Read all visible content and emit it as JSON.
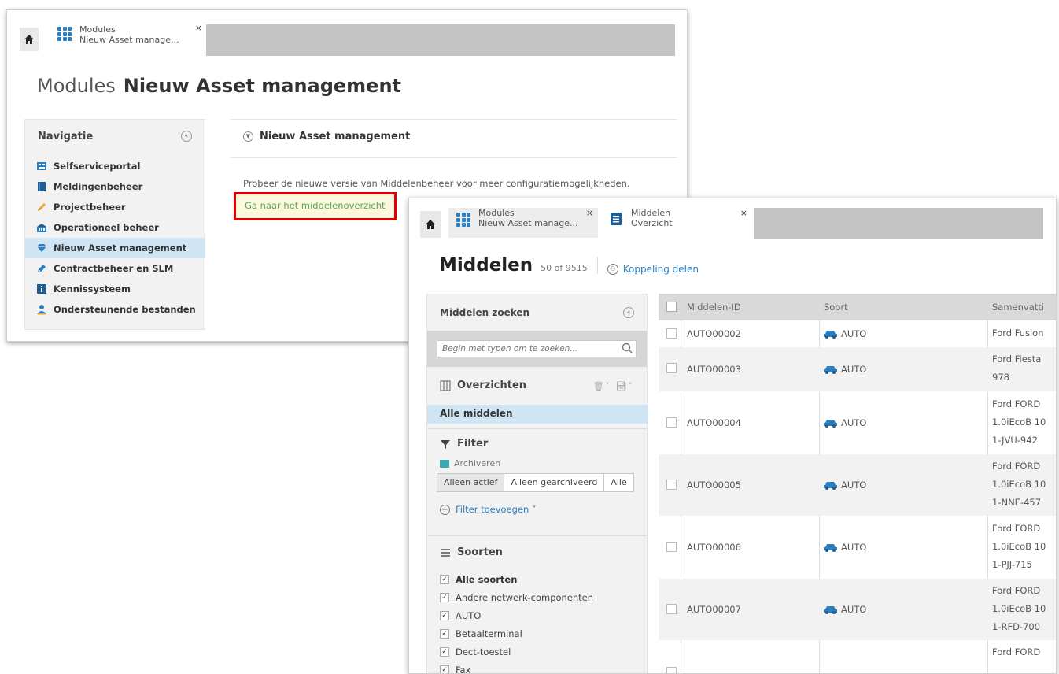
{
  "window1": {
    "tab": {
      "line1": "Modules",
      "line2": "Nieuw Asset manage...",
      "close": "×"
    },
    "title_light": "Modules",
    "title_bold": "Nieuw Asset management",
    "nav": {
      "header": "Navigatie",
      "collapse": "«",
      "items": [
        {
          "label": "Selfserviceportal",
          "icon": "portal-icon"
        },
        {
          "label": "Meldingenbeheer",
          "icon": "book-icon"
        },
        {
          "label": "Projectbeheer",
          "icon": "pencil-icon"
        },
        {
          "label": "Operationeel beheer",
          "icon": "building-icon"
        },
        {
          "label": "Nieuw Asset management",
          "icon": "diamond-icon",
          "active": true
        },
        {
          "label": "Contractbeheer en SLM",
          "icon": "pen-icon"
        },
        {
          "label": "Kennissysteem",
          "icon": "info-icon"
        },
        {
          "label": "Ondersteunende bestanden",
          "icon": "person-icon"
        }
      ]
    },
    "panel": {
      "header": "Nieuw Asset management",
      "description": "Probeer de nieuwe versie van Middelenbeheer voor meer configuratiemogelijkheden.",
      "link": "Ga naar het middelenoverzicht"
    }
  },
  "window2": {
    "tabs": [
      {
        "line1": "Modules",
        "line2": "Nieuw Asset manage...",
        "close": "×"
      },
      {
        "line1": "Middelen",
        "line2": "Overzicht",
        "close": "×"
      }
    ],
    "title": "Middelen",
    "count": "50 of 9515",
    "share": "Koppeling delen",
    "search": {
      "header": "Middelen zoeken",
      "collapse": "«",
      "placeholder": "Begin met typen om te zoeken..."
    },
    "overviews": {
      "header": "Overzichten",
      "actions": "🗑︎˅ 💾︎˅",
      "selected": "Alle middelen"
    },
    "filter": {
      "header": "Filter",
      "archive_label": "Archiveren",
      "segments": [
        "Alleen actief",
        "Alleen gearchiveerd",
        "Alle"
      ],
      "add": "Filter toevoegen ˅"
    },
    "types": {
      "header": "Soorten",
      "items": [
        {
          "label": "Alle soorten",
          "bold": true
        },
        {
          "label": "Andere netwerk-componenten"
        },
        {
          "label": "AUTO"
        },
        {
          "label": "Betaalterminal"
        },
        {
          "label": "Dect-toestel"
        },
        {
          "label": "Fax"
        }
      ]
    },
    "table": {
      "columns": [
        "Middelen-ID",
        "Soort",
        "Samenvatti"
      ],
      "rows": [
        {
          "id": "AUTO00002",
          "soort": "AUTO",
          "summary": [
            "Ford Fusion"
          ]
        },
        {
          "id": "AUTO00003",
          "soort": "AUTO",
          "summary": [
            "Ford Fiesta",
            "978"
          ]
        },
        {
          "id": "AUTO00004",
          "soort": "AUTO",
          "summary": [
            "Ford FORD",
            "1.0iEcoB 10",
            "1-JVU-942"
          ]
        },
        {
          "id": "AUTO00005",
          "soort": "AUTO",
          "summary": [
            "Ford FORD",
            "1.0iEcoB 10",
            "1-NNE-457"
          ]
        },
        {
          "id": "AUTO00006",
          "soort": "AUTO",
          "summary": [
            "Ford FORD",
            "1.0iEcoB 10",
            "1-PJJ-715"
          ]
        },
        {
          "id": "AUTO00007",
          "soort": "AUTO",
          "summary": [
            "Ford FORD",
            "1.0iEcoB 10",
            "1-RFD-700"
          ]
        },
        {
          "id": "",
          "soort": "",
          "summary": [
            "Ford FORD"
          ]
        }
      ]
    }
  },
  "colors": {
    "accent": "#2b7fc1",
    "active_bg": "#cfe5f3",
    "highlight_border": "#e00000",
    "link_green": "#5aa55a"
  }
}
